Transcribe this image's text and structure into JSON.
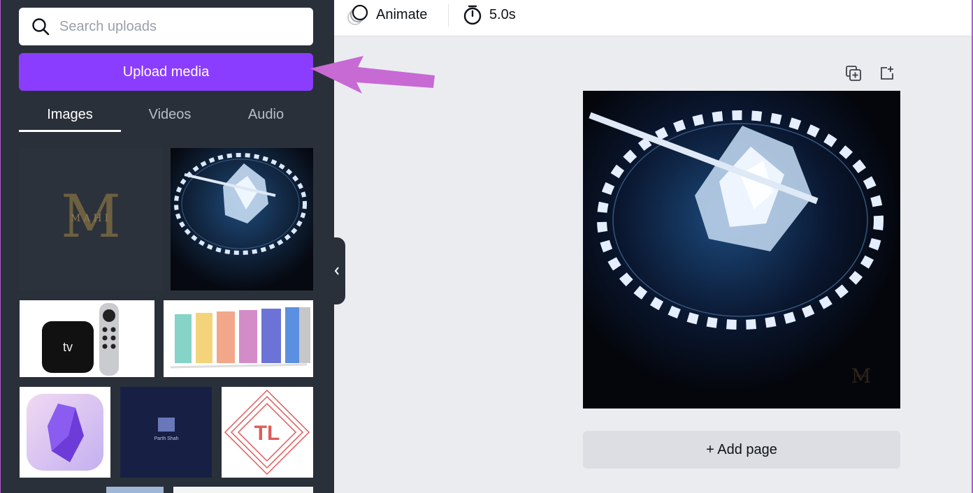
{
  "sidebar": {
    "search": {
      "placeholder": "Search uploads",
      "icon": "search-icon"
    },
    "upload_button": {
      "label": "Upload media",
      "color": "#8b3dff"
    },
    "tabs": [
      {
        "label": "Images",
        "active": true
      },
      {
        "label": "Videos",
        "active": false
      },
      {
        "label": "Audio",
        "active": false
      }
    ],
    "thumbnails": {
      "mahi_logo_letter": "M",
      "mahi_logo_text": "MAHI",
      "appletv_label": "tv",
      "parth_label": "Parth Shah",
      "tl_label": "TL"
    }
  },
  "topbar": {
    "animate_label": "Animate",
    "duration_label": "5.0s"
  },
  "canvas": {
    "add_page_label": "+ Add page",
    "watermark_letter": "M",
    "watermark_text": "MAHI"
  },
  "colors": {
    "panel_bg": "#2a3039",
    "accent": "#8b3dff",
    "annotation_arrow": "#c76ad4"
  }
}
